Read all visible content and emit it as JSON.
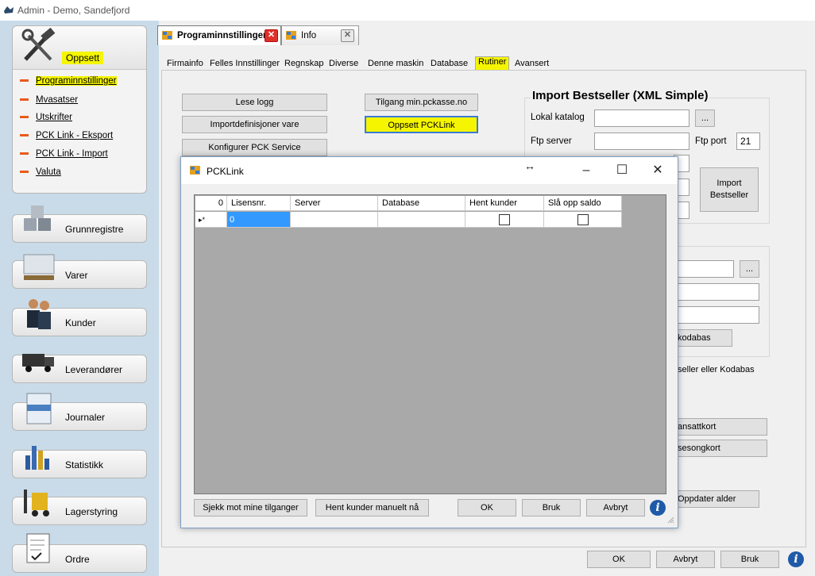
{
  "window": {
    "title": "Admin - Demo, Sandefjord"
  },
  "sidebar": {
    "setup": {
      "label": "Oppsett",
      "items": [
        {
          "label": "Programinnstillinger",
          "active": true
        },
        {
          "label": "Mvasatser"
        },
        {
          "label": "Utskrifter"
        },
        {
          "label": "PCK Link - Eksport"
        },
        {
          "label": "PCK Link - Import"
        },
        {
          "label": "Valuta"
        }
      ]
    },
    "nav": [
      {
        "label": "Grunnregistre",
        "icon": "cubes-icon"
      },
      {
        "label": "Varer",
        "icon": "pallet-icon"
      },
      {
        "label": "Kunder",
        "icon": "customers-icon"
      },
      {
        "label": "Leverandører",
        "icon": "truck-icon"
      },
      {
        "label": "Journaler",
        "icon": "journal-icon"
      },
      {
        "label": "Statistikk",
        "icon": "statistics-icon"
      },
      {
        "label": "Lagerstyring",
        "icon": "forklift-icon"
      },
      {
        "label": "Ordre",
        "icon": "order-icon"
      }
    ]
  },
  "doc_tabs": [
    {
      "label": "Programinnstillinger",
      "active": true
    },
    {
      "label": "Info"
    }
  ],
  "settings_tabs": [
    {
      "label": "Firmainfo"
    },
    {
      "label": "Felles Innstillinger"
    },
    {
      "label": "Regnskap"
    },
    {
      "label": "Diverse"
    },
    {
      "label": "Denne maskin"
    },
    {
      "label": "Database"
    },
    {
      "label": "Rutiner",
      "active": true
    },
    {
      "label": "Avansert"
    }
  ],
  "rutiner": {
    "read_log": "Lese logg",
    "import_defs": "Importdefinisjoner vare",
    "configure_service": "Konfigurer PCK Service",
    "access_site": "Tilgang min.pckasse.no",
    "setup_pcklink": "Oppsett PCKLink",
    "import_bestseller": {
      "title": "Import Bestseller (XML Simple)",
      "local_dir_label": "Lokal katalog",
      "ftp_server_label": "Ftp server",
      "ftp_port_label": "Ftp port",
      "ftp_port_value": "21",
      "browse": "...",
      "import_button": "Import\nBestseller"
    },
    "partial_texts": {
      "kodabas_button": "kodabas",
      "hint": "tseller eller Kodabas",
      "ansattkort": "ansattkort",
      "sesongkort": "sesongkort",
      "update_age": "Oppdater alder"
    }
  },
  "footer": {
    "ok": "OK",
    "cancel": "Avbryt",
    "apply": "Bruk"
  },
  "dialog": {
    "title": "PCKLink",
    "columns": [
      "0",
      "Lisensnr.",
      "Server",
      "Database",
      "Hent kunder",
      "Slå opp saldo"
    ],
    "new_row": {
      "marker": "▸*",
      "lisensnr": "0",
      "server": "",
      "database": "",
      "hent_kunder": false,
      "sla_opp_saldo": false
    },
    "buttons": {
      "check_access": "Sjekk mot mine tilganger",
      "fetch_customers": "Hent kunder manuelt nå",
      "ok": "OK",
      "apply": "Bruk",
      "cancel": "Avbryt"
    }
  },
  "colors": {
    "highlight": "#f5f500",
    "accent_dash": "#e95a1b",
    "sidebar_bg": "#c9dbe8",
    "selected_cell": "#3399ff"
  }
}
